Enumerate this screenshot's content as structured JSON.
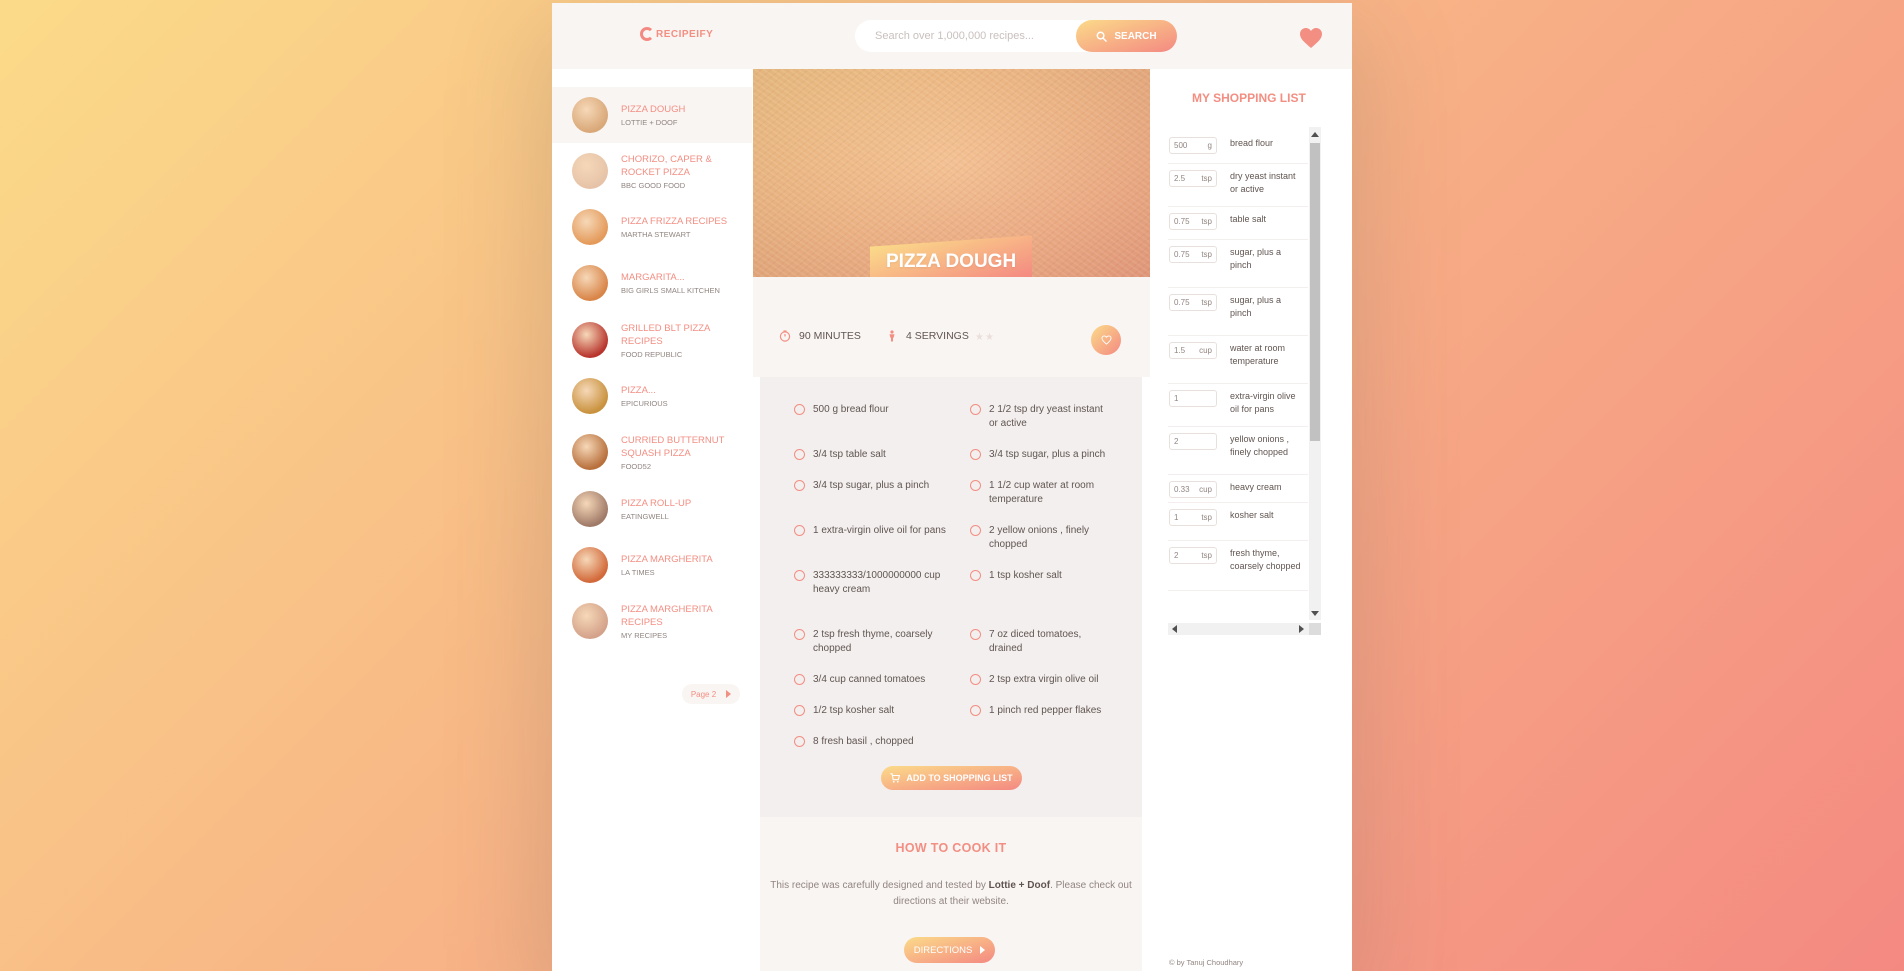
{
  "header": {
    "logo_text": "RECIPEIFY",
    "search_placeholder": "Search over 1,000,000 recipes...",
    "search_button_label": "SEARCH"
  },
  "results": [
    {
      "title": "PIZZA DOUGH",
      "publisher": "LOTTIE + DOOF",
      "active": true,
      "thumb": "#d9a878"
    },
    {
      "title": "CHORIZO, CAPER & ROCKET PIZZA",
      "publisher": "BBC GOOD FOOD",
      "active": false,
      "thumb": "#e6c3a8"
    },
    {
      "title": "PIZZA FRIZZA RECIPES",
      "publisher": "MARTHA STEWART",
      "active": false,
      "thumb": "#e49a5a"
    },
    {
      "title": "MARGARITA...",
      "publisher": "BIG GIRLS SMALL KITCHEN",
      "active": false,
      "thumb": "#d98548"
    },
    {
      "title": "GRILLED BLT PIZZA RECIPES",
      "publisher": "FOOD REPUBLIC",
      "active": false,
      "thumb": "#b8352e"
    },
    {
      "title": "PIZZA...",
      "publisher": "EPICURIOUS",
      "active": false,
      "thumb": "#c9923e"
    },
    {
      "title": "CURRIED BUTTERNUT SQUASH PIZZA",
      "publisher": "FOOD52",
      "active": false,
      "thumb": "#b8703c"
    },
    {
      "title": "PIZZA ROLL-UP",
      "publisher": "EATINGWELL",
      "active": false,
      "thumb": "#a07a68"
    },
    {
      "title": "PIZZA MARGHERITA",
      "publisher": "LA TIMES",
      "active": false,
      "thumb": "#d2693a"
    },
    {
      "title": "PIZZA MARGHERITA RECIPES",
      "publisher": "MY RECIPES",
      "active": false,
      "thumb": "#d4a28a"
    }
  ],
  "pagination": {
    "label": "Page 2"
  },
  "recipe": {
    "title": "PIZZA DOUGH",
    "minutes": "90",
    "minutes_unit": "MINUTES",
    "servings": "4",
    "servings_unit": "SERVINGS",
    "ingredients": [
      "500 g bread flour",
      "2 1/2 tsp dry yeast instant or active",
      "3/4 tsp table salt",
      "3/4 tsp sugar, plus a pinch",
      "3/4 tsp sugar, plus a pinch",
      "1 1/2 cup water at room temperature",
      "1 extra-virgin olive oil for pans",
      "2 yellow onions , finely chopped",
      "333333333/1000000000 cup heavy cream",
      "1 tsp kosher salt",
      "2 tsp fresh thyme, coarsely chopped",
      "7 oz diced tomatoes, drained",
      "3/4 cup canned tomatoes",
      "2 tsp extra virgin olive oil",
      "1/2 tsp kosher salt",
      "1 pinch red pepper flakes",
      "8 fresh basil , chopped"
    ],
    "add_button_label": "ADD TO SHOPPING LIST"
  },
  "directions": {
    "heading": "HOW TO COOK IT",
    "text_before": "This recipe was carefully designed and tested by ",
    "publisher": "Lottie + Doof",
    "text_after": ". Please check out directions at their website.",
    "button_label": "DIRECTIONS"
  },
  "shopping": {
    "heading": "MY SHOPPING LIST",
    "items": [
      {
        "qty": "500",
        "unit": "g",
        "desc": "bread flour"
      },
      {
        "qty": "2.5",
        "unit": "tsp",
        "desc": "dry yeast instant or active"
      },
      {
        "qty": "0.75",
        "unit": "tsp",
        "desc": "table salt"
      },
      {
        "qty": "0.75",
        "unit": "tsp",
        "desc": "sugar, plus a pinch"
      },
      {
        "qty": "0.75",
        "unit": "tsp",
        "desc": "sugar, plus a pinch"
      },
      {
        "qty": "1.5",
        "unit": "cup",
        "desc": "water at room temperature"
      },
      {
        "qty": "1",
        "unit": "",
        "desc": "extra-virgin olive oil for pans"
      },
      {
        "qty": "2",
        "unit": "",
        "desc": "yellow onions , finely chopped"
      },
      {
        "qty": "0.33",
        "unit": "cup",
        "desc": "heavy cream"
      },
      {
        "qty": "1",
        "unit": "tsp",
        "desc": "kosher salt"
      },
      {
        "qty": "2",
        "unit": "tsp",
        "desc": "fresh thyme, coarsely chopped"
      }
    ]
  },
  "footer": {
    "copyright": "© by Tanuj Choudhary"
  },
  "colors": {
    "accent": "#f38e82",
    "gradient_start": "#fbdb89",
    "gradient_end": "#f48982",
    "panel": "#f9f5f3"
  }
}
